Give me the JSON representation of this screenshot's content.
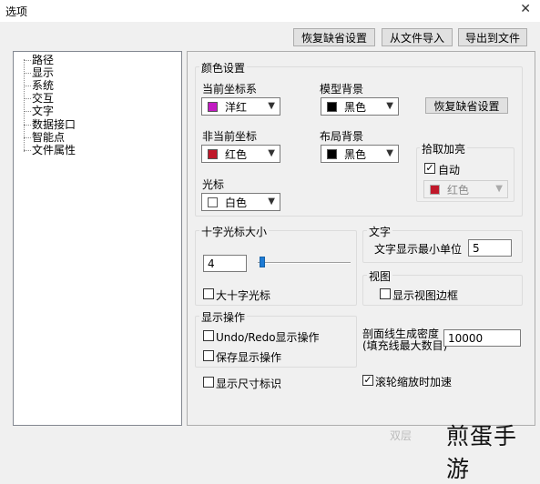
{
  "window": {
    "title": "选项",
    "close_glyph": "✕"
  },
  "toolbar": {
    "restore_defaults": "恢复缺省设置",
    "import_file": "从文件导入",
    "export_file": "导出到文件"
  },
  "tree": {
    "items": [
      "路径",
      "显示",
      "系统",
      "交互",
      "文字",
      "数据接口",
      "智能点",
      "文件属性"
    ]
  },
  "color_settings": {
    "title": "颜色设置",
    "current_axis": {
      "label": "当前坐标系",
      "value": "洋红",
      "color": "#c21ac2"
    },
    "model_bg": {
      "label": "模型背景",
      "value": "黑色",
      "color": "#000000"
    },
    "restore_btn": "恢复缺省设置",
    "noncurrent_axis": {
      "label": "非当前坐标",
      "value": "红色",
      "color": "#c0182a"
    },
    "layout_bg": {
      "label": "布局背景",
      "value": "黑色",
      "color": "#000000"
    },
    "pick_highlight": {
      "title": "拾取加亮",
      "auto_label": "自动",
      "auto_checked": true,
      "value": "红色",
      "color": "#c0182a"
    },
    "cursor": {
      "label": "光标",
      "value": "白色",
      "color": "#ffffff"
    }
  },
  "crosshair": {
    "title": "十字光标大小",
    "size_value": "4",
    "slider_level": 4,
    "big_crosshair_label": "大十字光标",
    "big_crosshair_checked": false
  },
  "text": {
    "title": "文字",
    "min_unit_label": "文字显示最小单位",
    "min_unit_value": "5"
  },
  "view": {
    "title": "视图",
    "show_border_label": "显示视图边框",
    "show_border_checked": false
  },
  "display_ops": {
    "title": "显示操作",
    "undo_redo_label": "Undo/Redo显示操作",
    "undo_redo_checked": false,
    "save_display_label": "保存显示操作",
    "save_display_checked": false
  },
  "section_line": {
    "label_line1": "剖面线生成密度",
    "label_line2": "(填充线最大数目)",
    "value": "10000"
  },
  "show_dim_label": "显示尺寸标识",
  "show_dim_checked": false,
  "wheel_zoom_label": "滚轮缩放时加速",
  "wheel_zoom_checked": true,
  "watermark": {
    "main": "煎蛋手游",
    "sub": "双层"
  }
}
